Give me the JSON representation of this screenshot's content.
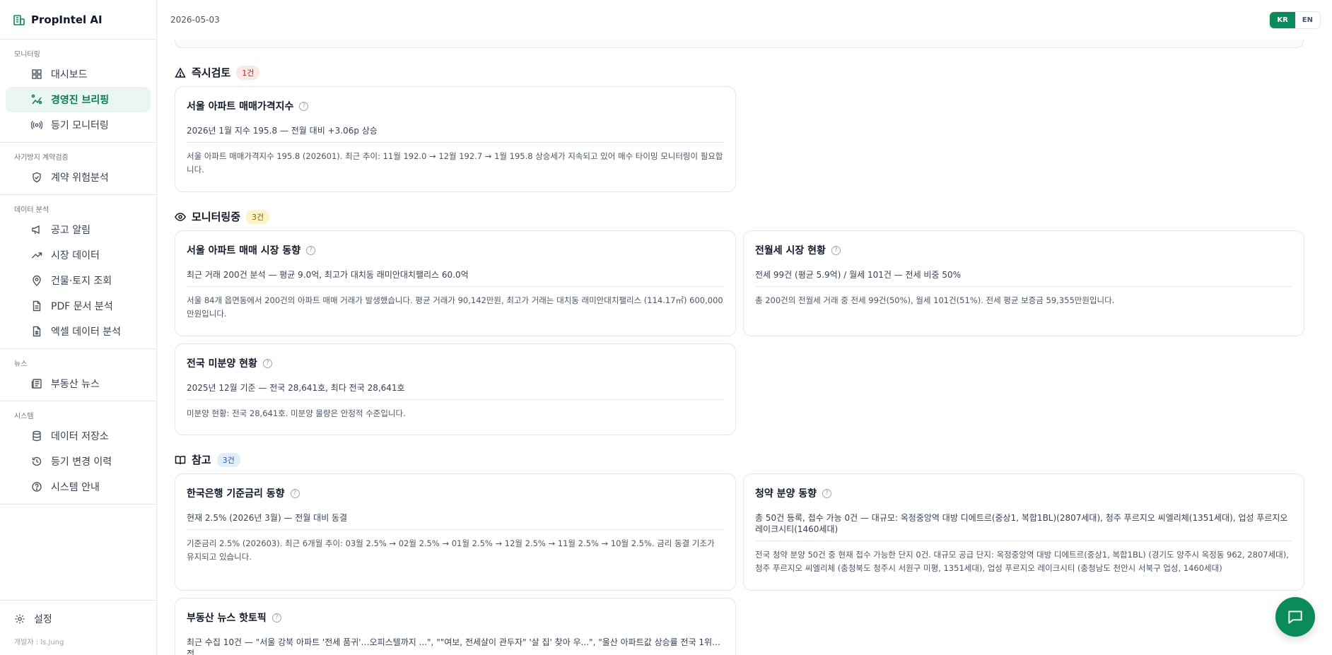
{
  "app": {
    "name": "PropIntel AI"
  },
  "header": {
    "date": "2026-05-03",
    "lang": {
      "kr": "KR",
      "en": "EN"
    }
  },
  "sidebar": {
    "sections": [
      {
        "label": "모니터링",
        "items": [
          {
            "label": "대시보드",
            "icon": "dashboard-icon"
          },
          {
            "label": "경영진 브리핑",
            "icon": "briefing-icon",
            "active": true
          },
          {
            "label": "등기 모니터링",
            "icon": "radio-icon"
          }
        ]
      },
      {
        "label": "사기방지 계약검증",
        "items": [
          {
            "label": "계약 위험분석",
            "icon": "shield-icon"
          }
        ]
      },
      {
        "label": "데이터 분석",
        "items": [
          {
            "label": "공고 알림",
            "icon": "megaphone-icon"
          },
          {
            "label": "시장 데이터",
            "icon": "trend-icon"
          },
          {
            "label": "건물·토지 조회",
            "icon": "map-pin-icon"
          },
          {
            "label": "PDF 문서 분석",
            "icon": "file-icon"
          },
          {
            "label": "엑셀 데이터 분석",
            "icon": "spreadsheet-icon"
          }
        ]
      },
      {
        "label": "뉴스",
        "items": [
          {
            "label": "부동산 뉴스",
            "icon": "newspaper-icon"
          }
        ]
      },
      {
        "label": "시스템",
        "items": [
          {
            "label": "데이터 저장소",
            "icon": "database-icon"
          },
          {
            "label": "등기 변경 이력",
            "icon": "history-icon"
          },
          {
            "label": "시스템 안내",
            "icon": "help-circle-icon"
          }
        ]
      }
    ],
    "settings": "설정",
    "developer": "개발자 : ls.Jung"
  },
  "main": {
    "urgent": {
      "title": "즉시검토",
      "count": "1건",
      "cards": [
        {
          "title": "서울 아파트 매매가격지수",
          "help": "?",
          "summary": "2026년 1월 지수 195.8 — 전월 대비 +3.06p 상승",
          "detail": "서울 아파트 매매가격지수 195.8 (202601). 최근 추이: 11월 192.0 → 12월 192.7 → 1월 195.8 상승세가 지속되고 있어 매수 타이밍 모니터링이 필요합니다."
        }
      ]
    },
    "monitoring": {
      "title": "모니터링중",
      "count": "3건",
      "cards": [
        {
          "title": "서울 아파트 매매 시장 동향",
          "help": "?",
          "summary": "최근 거래 200건 분석 — 평균 9.0억, 최고가 대치동 래미안대치팰리스 60.0억",
          "detail": "서울 84개 읍면동에서 200건의 아파트 매매 거래가 발생했습니다. 평균 거래가 90,142만원, 최고가 거래는 대치동 래미안대치팰리스 (114.17㎡) 600,000만원입니다."
        },
        {
          "title": "전월세 시장 현황",
          "help": "?",
          "summary": "전세 99건 (평균 5.9억) / 월세 101건 — 전세 비중 50%",
          "detail": "총 200건의 전월세 거래 중 전세 99건(50%), 월세 101건(51%). 전세 평균 보증금 59,355만원입니다."
        },
        {
          "title": "전국 미분양 현황",
          "help": "?",
          "summary": "2025년 12월 기준 — 전국 28,641호, 최다 전국 28,641호",
          "detail": "미분양 현황: 전국 28,641호. 미분양 물량은 안정적 수준입니다."
        }
      ]
    },
    "reference": {
      "title": "참고",
      "count": "3건",
      "cards": [
        {
          "title": "한국은행 기준금리 동향",
          "help": "?",
          "summary": "현재 2.5% (2026년 3월) — 전월 대비 동결",
          "detail": "기준금리 2.5% (202603). 최근 6개월 추이: 03월 2.5% → 02월 2.5% → 01월 2.5% → 12월 2.5% → 11월 2.5% → 10월 2.5%. 금리 동결 기조가 유지되고 있습니다."
        },
        {
          "title": "청약 분양 동향",
          "help": "?",
          "summary": "총 50건 등록, 접수 가능 0건 — 대규모: 옥정중앙역 대방 디에트르(중상1, 복합1BL)(2807세대), 청주 푸르지오 씨엘리체(1351세대), 업성 푸르지오 레이크시티(1460세대)",
          "detail": "전국 청약 분양 50건 중 현재 접수 가능한 단지 0건. 대규모 공급 단지: 옥정중앙역 대방 디에트르(중상1, 복합1BL) (경기도 양주시 옥정동 962, 2807세대), 청주 푸르지오 씨엘리체 (충청북도 청주시 서원구 미평, 1351세대), 업성 푸르지오 레이크시티 (충청남도 천안시 서북구 업성, 1460세대)"
        },
        {
          "title": "부동산 뉴스 핫토픽",
          "help": "?",
          "summary": "최근 수집 10건 — \"서울 강북 아파트 '전세 품귀'…오피스텔까지 ...\", \"\"여보, 전세살이 관두자\" '살 집' 찾아 우...\", \"울산 아파트값 상승률 전국 1위…전",
          "detail": ""
        }
      ]
    }
  }
}
